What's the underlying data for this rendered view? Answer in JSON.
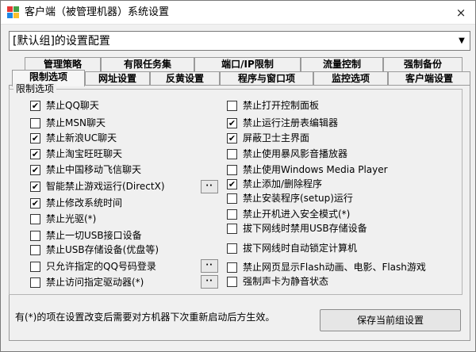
{
  "window": {
    "title": "客户端（被管理机器）系统设置",
    "close_glyph": "×",
    "icon": "app-logo-icon"
  },
  "profile": {
    "selected": "[默认组]的设置配置",
    "arrow_glyph": "▼"
  },
  "tabs": {
    "back": [
      {
        "label": "管理策略"
      },
      {
        "label": "有限任务集"
      },
      {
        "label": "端口/IP限制"
      },
      {
        "label": "流量控制"
      },
      {
        "label": "强制备份"
      }
    ],
    "front": [
      {
        "label": "限制选项",
        "active": true
      },
      {
        "label": "网址设置",
        "active": false
      },
      {
        "label": "反黄设置",
        "active": false
      },
      {
        "label": "程序与窗口项",
        "active": false
      },
      {
        "label": "监控选项",
        "active": false
      },
      {
        "label": "客户端设置",
        "active": false
      }
    ]
  },
  "group": {
    "title": "限制选项"
  },
  "options": {
    "left": [
      {
        "label": "禁止QQ聊天",
        "checked": true
      },
      {
        "label": "禁止MSN聊天",
        "checked": false
      },
      {
        "label": "禁止新浪UC聊天",
        "checked": true
      },
      {
        "label": "禁止淘宝旺旺聊天",
        "checked": true
      },
      {
        "label": "禁止中国移动飞信聊天",
        "checked": true
      },
      {
        "label": "智能禁止游戏运行(DirectX)",
        "checked": true
      },
      {
        "label": "禁止修改系统时间",
        "checked": true
      },
      {
        "label": "禁止光驱(*)",
        "checked": false
      },
      {
        "label": "禁止一切USB接口设备",
        "checked": false
      },
      {
        "label": "禁止USB存储设备(优盘等)",
        "checked": false
      },
      {
        "label": "只允许指定的QQ号码登录",
        "checked": false
      },
      {
        "label": "禁止访问指定驱动器(*)",
        "checked": false
      }
    ],
    "right": [
      {
        "label": "禁止打开控制面板",
        "checked": false
      },
      {
        "label": "禁止运行注册表编辑器",
        "checked": true
      },
      {
        "label": "屏蔽卫士主界面",
        "checked": true
      },
      {
        "label": "禁止使用暴风影音播放器",
        "checked": false
      },
      {
        "label": "禁止使用Windows Media Player",
        "checked": false
      },
      {
        "label": "禁止添加/删除程序",
        "checked": true
      },
      {
        "label": "禁止安装程序(setup)运行",
        "checked": false
      },
      {
        "label": "禁止开机进入安全模式(*)",
        "checked": false
      },
      {
        "label": "拔下网线时禁用USB存储设备",
        "checked": false
      },
      {
        "label": "拔下网线时自动锁定计算机",
        "checked": false
      },
      {
        "label": "禁止网页显示Flash动画、电影、Flash游戏",
        "checked": false
      },
      {
        "label": "强制声卡为静音状态",
        "checked": false
      }
    ]
  },
  "dots_label": "··",
  "footer": {
    "note": "有(*)的项在设置改变后需要对方机器下次重新启动后方生效。",
    "save_button": "保存当前组设置"
  }
}
